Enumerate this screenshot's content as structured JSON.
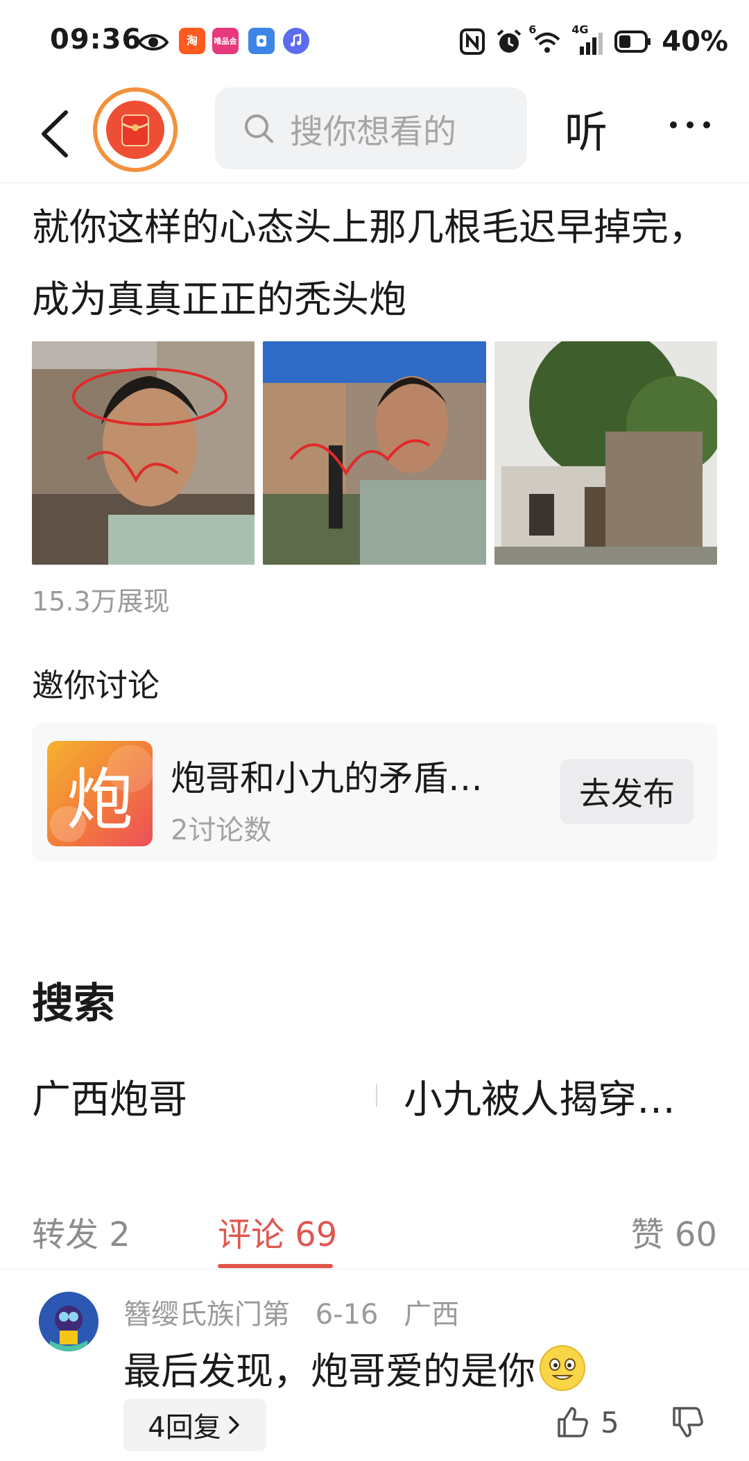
{
  "status_bar": {
    "time": "09:36",
    "notif_apps": [
      "淘",
      "唯品会",
      "",
      ""
    ],
    "network": "4G",
    "wifi_badge": "6",
    "battery": "40%"
  },
  "nav": {
    "search_placeholder": "搜你想看的",
    "listen_label": "听"
  },
  "post": {
    "text": "就你这样的心态头上那几根毛迟早掉完，成为真真正正的秃头炮",
    "views": "15.3万展现"
  },
  "discussion": {
    "title": "邀你讨论",
    "topic": {
      "icon_char": "炮",
      "name": "炮哥和小九的矛盾…",
      "count": "2讨论数",
      "button": "去发布"
    }
  },
  "search": {
    "title": "搜索",
    "items": [
      "广西炮哥",
      "小九被人揭穿…"
    ]
  },
  "tabs": {
    "repost": "转发 2",
    "comments": "评论 69",
    "likes": "赞 60"
  },
  "comment": {
    "user": "簪缨氏族门第",
    "date": "6-16",
    "location": "广西",
    "text": "最后发现，炮哥爱的是你",
    "replies": "4回复",
    "likes": "5"
  },
  "colors": {
    "accent": "#e0564f",
    "logo_ring": "#f2913c",
    "logo_core": "#ee4f34"
  }
}
